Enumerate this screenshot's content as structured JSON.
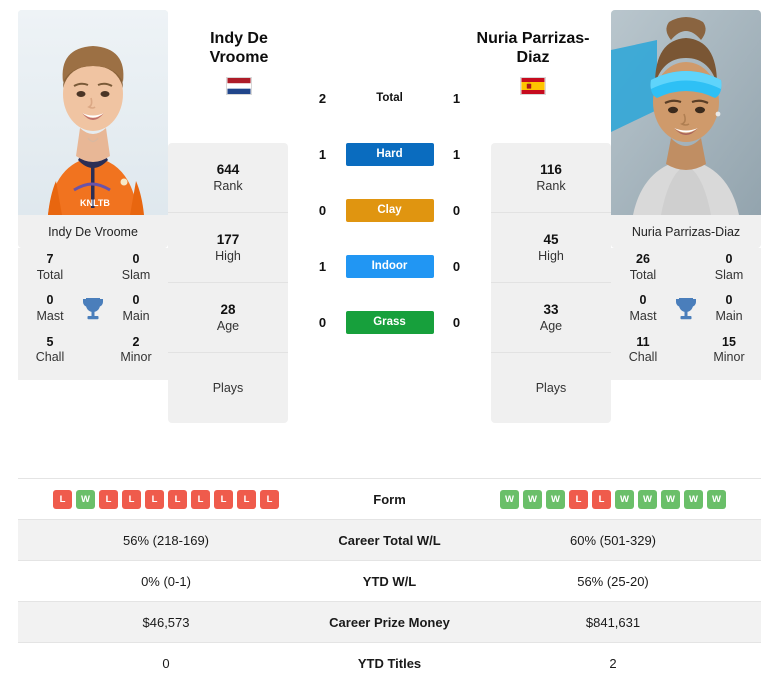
{
  "players": {
    "left": {
      "name": "Indy De Vroome",
      "name_line1": "Indy De",
      "name_line2": "Vroome",
      "photo_name": "Indy De Vroome",
      "country": "Netherlands",
      "flag_icon": "flag-netherlands-icon",
      "rank": "644",
      "rank_label": "Rank",
      "high": "177",
      "high_label": "High",
      "age": "28",
      "age_label": "Age",
      "plays_label": "Plays",
      "plays_value": "",
      "titles": {
        "total": "7",
        "total_label": "Total",
        "slam": "0",
        "slam_label": "Slam",
        "mast": "0",
        "mast_label": "Mast",
        "main": "0",
        "main_label": "Main",
        "chall": "5",
        "chall_label": "Chall",
        "minor": "2",
        "minor_label": "Minor"
      },
      "form": [
        "L",
        "W",
        "L",
        "L",
        "L",
        "L",
        "L",
        "L",
        "L",
        "L"
      ],
      "career_total_wl": "56% (218-169)",
      "ytd_wl": "0% (0-1)",
      "career_prize_money": "$46,573",
      "ytd_titles": "0"
    },
    "right": {
      "name": "Nuria Parrizas-Diaz",
      "name_line1": "Nuria Parrizas-",
      "name_line2": "Diaz",
      "photo_name": "Nuria Parrizas-Diaz",
      "country": "Spain",
      "flag_icon": "flag-spain-icon",
      "rank": "116",
      "rank_label": "Rank",
      "high": "45",
      "high_label": "High",
      "age": "33",
      "age_label": "Age",
      "plays_label": "Plays",
      "plays_value": "",
      "titles": {
        "total": "26",
        "total_label": "Total",
        "slam": "0",
        "slam_label": "Slam",
        "mast": "0",
        "mast_label": "Mast",
        "main": "0",
        "main_label": "Main",
        "chall": "11",
        "chall_label": "Chall",
        "minor": "15",
        "minor_label": "Minor"
      },
      "form": [
        "W",
        "W",
        "W",
        "L",
        "L",
        "W",
        "W",
        "W",
        "W",
        "W"
      ],
      "career_total_wl": "60% (501-329)",
      "ytd_wl": "56% (25-20)",
      "career_prize_money": "$841,631",
      "ytd_titles": "2"
    }
  },
  "head_to_head": {
    "rows": [
      {
        "label": "Total",
        "left": "2",
        "right": "1",
        "style": "plain",
        "color": ""
      },
      {
        "label": "Hard",
        "left": "1",
        "right": "1",
        "style": "pill",
        "color": "#0a6cbf"
      },
      {
        "label": "Clay",
        "left": "0",
        "right": "0",
        "style": "pill",
        "color": "#e09510"
      },
      {
        "label": "Indoor",
        "left": "1",
        "right": "0",
        "style": "pill",
        "color": "#2196f3"
      },
      {
        "label": "Grass",
        "left": "0",
        "right": "0",
        "style": "pill",
        "color": "#17a03c"
      }
    ]
  },
  "comparison_table": {
    "rows": [
      {
        "label": "Form",
        "type": "form",
        "left": "",
        "right": ""
      },
      {
        "label": "Career Total W/L",
        "type": "text",
        "left": "56% (218-169)",
        "right": "60% (501-329)"
      },
      {
        "label": "YTD W/L",
        "type": "text",
        "left": "0% (0-1)",
        "right": "56% (25-20)"
      },
      {
        "label": "Career Prize Money",
        "type": "text",
        "left": "$46,573",
        "right": "$841,631"
      },
      {
        "label": "YTD Titles",
        "type": "text",
        "left": "0",
        "right": "2"
      }
    ]
  },
  "colors": {
    "win": "#6abf69",
    "loss": "#ef5b4c",
    "hard": "#0a6cbf",
    "clay": "#e09510",
    "indoor": "#2196f3",
    "grass": "#17a03c",
    "trophy": "#4a7ebb",
    "panel": "#f0f0f0",
    "row_shade": "#f2f2f2"
  }
}
